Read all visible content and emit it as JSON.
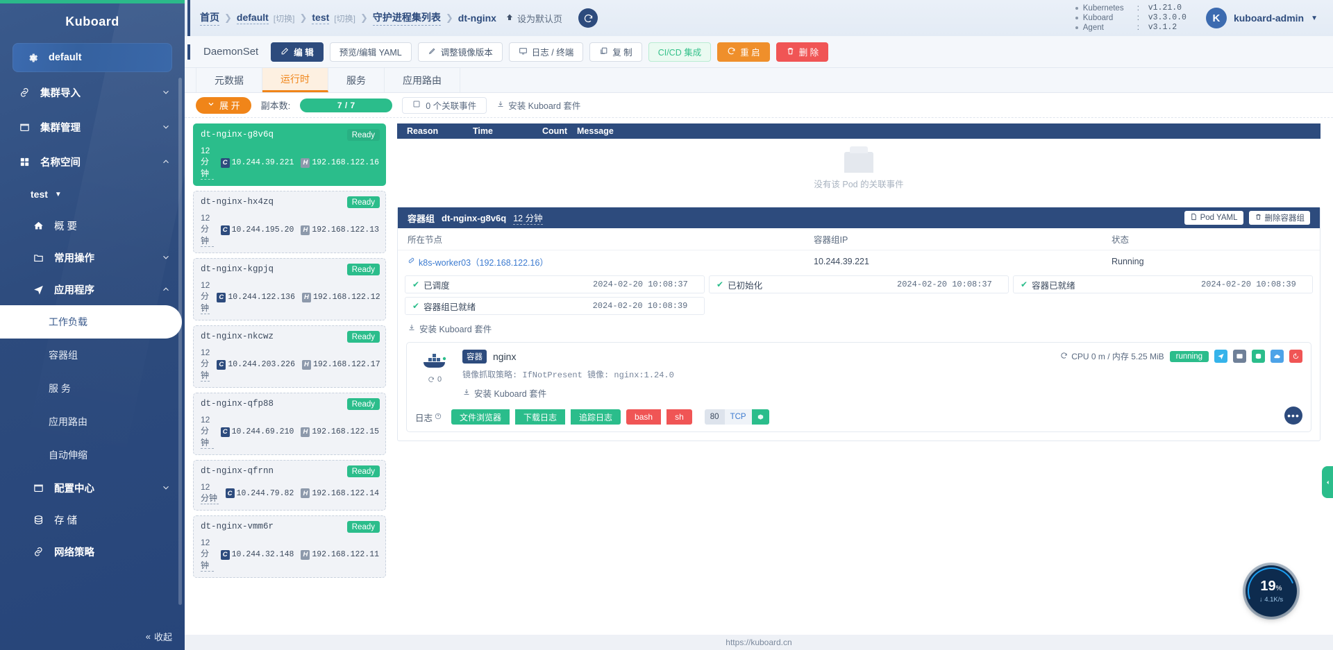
{
  "sidebar": {
    "title": "Kuboard",
    "cluster": {
      "label": "default",
      "icon": "gear-icon"
    },
    "items": [
      {
        "label": "集群导入",
        "icon": "link-icon",
        "chevron": "down"
      },
      {
        "label": "集群管理",
        "icon": "box-icon",
        "chevron": "down"
      },
      {
        "label": "名称空间",
        "icon": "grid-icon",
        "chevron": "up"
      }
    ],
    "namespace": {
      "label": "test",
      "caret": "▼"
    },
    "ns_items": [
      {
        "label": "概 要",
        "icon": "home-icon",
        "chevron": ""
      },
      {
        "label": "常用操作",
        "icon": "folder-icon",
        "chevron": "down"
      },
      {
        "label": "应用程序",
        "icon": "send-icon",
        "chevron": "up"
      }
    ],
    "app_subitems": [
      {
        "label": "工作负载",
        "active": true
      },
      {
        "label": "容器组",
        "active": false
      },
      {
        "label": "服 务",
        "active": false
      },
      {
        "label": "应用路由",
        "active": false
      },
      {
        "label": "自动伸缩",
        "active": false
      }
    ],
    "bottom_items": [
      {
        "label": "配置中心",
        "icon": "box-icon",
        "chevron": "down"
      },
      {
        "label": "存 储",
        "icon": "database-icon",
        "chevron": ""
      },
      {
        "label": "网络策略",
        "icon": "link-icon",
        "chevron": ""
      }
    ],
    "collapse": "收起"
  },
  "header": {
    "breadcrumb": [
      {
        "text": "首页",
        "type": "link"
      },
      {
        "text": "default",
        "type": "link"
      },
      {
        "text": "[切换]",
        "type": "switch"
      },
      {
        "text": "test",
        "type": "link"
      },
      {
        "text": "[切换]",
        "type": "switch"
      },
      {
        "text": "守护进程集列表",
        "type": "link"
      },
      {
        "text": "dt-nginx",
        "type": "plain"
      }
    ],
    "set_default": "设为默认页",
    "refresh_icon": "refresh-icon",
    "versions": [
      {
        "name": "Kubernetes",
        "value": "v1.21.0"
      },
      {
        "name": "Kuboard",
        "value": "v3.3.0.0"
      },
      {
        "name": "Agent",
        "value": "v3.1.2"
      }
    ],
    "user": {
      "initial": "K",
      "name": "kuboard-admin",
      "caret": "▼"
    }
  },
  "toolbar": {
    "kind": "DaemonSet",
    "buttons": [
      {
        "label": "编 辑",
        "style": "primary",
        "icon": "edit-icon"
      },
      {
        "label": "预览/编辑 YAML",
        "style": "plain",
        "icon": ""
      },
      {
        "label": "调整镜像版本",
        "style": "plain",
        "icon": "pen-icon"
      },
      {
        "label": "日志 / 终端",
        "style": "plain",
        "icon": "monitor-icon"
      },
      {
        "label": "复 制",
        "style": "plain",
        "icon": "copy-icon"
      },
      {
        "label": "CI/CD 集成",
        "style": "success",
        "icon": ""
      },
      {
        "label": "重 启",
        "style": "warn",
        "icon": "restart-icon"
      },
      {
        "label": "删 除",
        "style": "danger",
        "icon": "trash-icon"
      }
    ]
  },
  "tabs": [
    {
      "label": "元数据",
      "active": false
    },
    {
      "label": "运行时",
      "active": true
    },
    {
      "label": "服务",
      "active": false
    },
    {
      "label": "应用路由",
      "active": false
    }
  ],
  "replica_bar": {
    "expand_label": "展 开",
    "replicas_label": "副本数:",
    "replicas_value": "7 / 7",
    "events_label": "0 个关联事件",
    "install_label": "安装 Kuboard 套件"
  },
  "pods": [
    {
      "name": "dt-nginx-g8v6q",
      "age": "12 分钟",
      "pod_ip": "10.244.39.221",
      "host_ip": "192.168.122.16",
      "status": "Ready",
      "selected": true
    },
    {
      "name": "dt-nginx-hx4zq",
      "age": "12 分钟",
      "pod_ip": "10.244.195.20",
      "host_ip": "192.168.122.13",
      "status": "Ready",
      "selected": false
    },
    {
      "name": "dt-nginx-kgpjq",
      "age": "12 分钟",
      "pod_ip": "10.244.122.136",
      "host_ip": "192.168.122.12",
      "status": "Ready",
      "selected": false
    },
    {
      "name": "dt-nginx-nkcwz",
      "age": "12 分钟",
      "pod_ip": "10.244.203.226",
      "host_ip": "192.168.122.17",
      "status": "Ready",
      "selected": false
    },
    {
      "name": "dt-nginx-qfp88",
      "age": "12 分钟",
      "pod_ip": "10.244.69.210",
      "host_ip": "192.168.122.15",
      "status": "Ready",
      "selected": false
    },
    {
      "name": "dt-nginx-qfrnn",
      "age": "12 分钟",
      "pod_ip": "10.244.79.82",
      "host_ip": "192.168.122.14",
      "status": "Ready",
      "selected": false
    },
    {
      "name": "dt-nginx-vmm6r",
      "age": "12 分钟",
      "pod_ip": "10.244.32.148",
      "host_ip": "192.168.122.11",
      "status": "Ready",
      "selected": false
    }
  ],
  "events": {
    "columns": [
      "Reason",
      "Time",
      "Count",
      "Message"
    ],
    "empty_text": "没有该 Pod 的关联事件"
  },
  "pod_detail": {
    "title": "容器组",
    "name": "dt-nginx-g8v6q",
    "age": "12 分钟",
    "actions": [
      {
        "label": "Pod YAML",
        "icon": "file-icon"
      },
      {
        "label": "删除容器组",
        "icon": "trash-icon"
      }
    ],
    "table_headers": [
      "所在节点",
      "容器组IP",
      "状态"
    ],
    "node": "k8s-worker03（192.168.122.16）",
    "pod_ip": "10.244.39.221",
    "status": "Running",
    "stages": [
      {
        "label": "已调度",
        "time": "2024-02-20 10:08:37"
      },
      {
        "label": "已初始化",
        "time": "2024-02-20 10:08:37"
      },
      {
        "label": "容器已就绪",
        "time": "2024-02-20 10:08:39"
      },
      {
        "label": "容器组已就绪",
        "time": "2024-02-20 10:08:39"
      }
    ],
    "install_label": "安装 Kuboard 套件"
  },
  "container": {
    "badge": "容器",
    "name": "nginx",
    "restart_count": "0",
    "pull_policy_line": "镜像抓取策略: IfNotPresent    镜像: nginx:1.24.0",
    "install_label": "安装 Kuboard 套件",
    "metrics": "CPU 0 m / 内存 5.25 MiB",
    "metrics_cpu": "CPU 0 m",
    "metrics_mem": "5.25 MiB",
    "state": "running",
    "logs_label": "日志",
    "log_buttons": [
      {
        "label": "文件浏览器",
        "color": "green"
      },
      {
        "label": "下载日志",
        "color": "green"
      },
      {
        "label": "追踪日志",
        "color": "green"
      },
      {
        "label": "bash",
        "color": "red"
      },
      {
        "label": "sh",
        "color": "red"
      }
    ],
    "port": {
      "number": "80",
      "protocol": "TCP"
    },
    "more": "•••"
  },
  "gauge": {
    "percent": "19",
    "unit": "%",
    "network": "4.1K/s"
  },
  "footer": {
    "url": "https://kuboard.cn"
  },
  "colors": {
    "sidebar": "#2d4b7d",
    "green": "#2bbd8b",
    "orange": "#f08519",
    "red": "#f05555",
    "accent_blue": "#3c7bd0"
  }
}
